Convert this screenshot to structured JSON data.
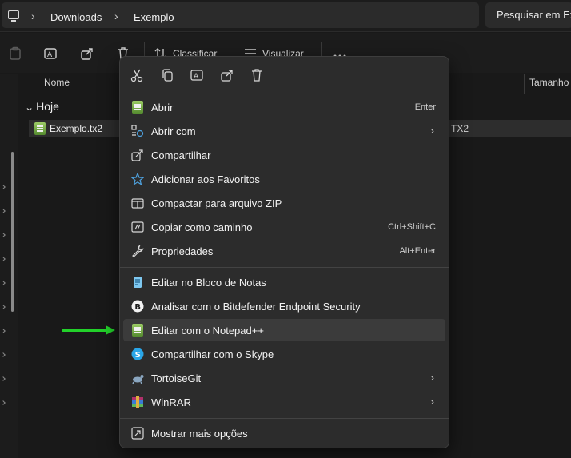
{
  "address": {
    "crumbs": [
      "Downloads",
      "Exemplo"
    ],
    "search_placeholder": "Pesquisar em Exemplo"
  },
  "toolbar": {
    "sort_label": "Classificar",
    "view_label": "Visualizar"
  },
  "columns": {
    "name": "Nome",
    "size": "Tamanho"
  },
  "group": {
    "label": "Hoje"
  },
  "file": {
    "name": "Exemplo.tx2",
    "type": "TX2"
  },
  "menu": {
    "items": [
      {
        "label": "Abrir",
        "shortcut": "Enter",
        "icon": "notepad-plus-icon"
      },
      {
        "label": "Abrir com",
        "submenu": true,
        "icon": "open-with-icon"
      },
      {
        "label": "Compartilhar",
        "icon": "share-icon"
      },
      {
        "label": "Adicionar aos Favoritos",
        "icon": "star-icon"
      },
      {
        "label": "Compactar para arquivo ZIP",
        "icon": "zip-icon"
      },
      {
        "label": "Copiar como caminho",
        "shortcut": "Ctrl+Shift+C",
        "icon": "copy-path-icon"
      },
      {
        "label": "Propriedades",
        "shortcut": "Alt+Enter",
        "icon": "wrench-icon"
      },
      {
        "label": "Editar no Bloco de Notas",
        "icon": "notepad-icon"
      },
      {
        "label": "Analisar com o Bitdefender Endpoint Security",
        "icon": "bitdefender-icon"
      },
      {
        "label": "Editar com o Notepad++",
        "highlighted": true,
        "icon": "notepad-plus-icon"
      },
      {
        "label": "Compartilhar com o Skype",
        "icon": "skype-icon"
      },
      {
        "label": "TortoiseGit",
        "submenu": true,
        "icon": "tortoisegit-icon"
      },
      {
        "label": "WinRAR",
        "submenu": true,
        "icon": "winrar-icon"
      },
      {
        "label": "Mostrar mais opções",
        "icon": "more-options-icon"
      }
    ]
  },
  "colors": {
    "menu_bg": "#2c2c2c",
    "highlight": "#3b3b3b",
    "arrow": "#22d12a"
  }
}
